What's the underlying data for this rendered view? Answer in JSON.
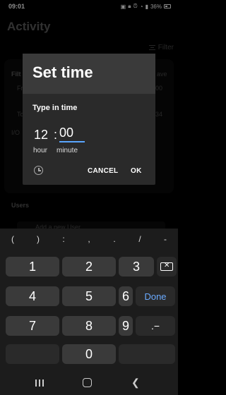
{
  "status_bar": {
    "time": "09:01",
    "battery": "36%",
    "icons": [
      "notification-icon",
      "lock-icon",
      "alarm-icon",
      "wifi-icon",
      "signal-icon",
      "battery-icon"
    ]
  },
  "background": {
    "title": "Activity",
    "filter_label": "Filter",
    "card_label": "Filt",
    "card_action": "ave",
    "field_from": "Fr",
    "field_from_value": "00",
    "field_to": "To",
    "field_to_value": "34",
    "io_label": "I/O",
    "users_label": "Users",
    "add_user": "Add a new User"
  },
  "dialog": {
    "title": "Set time",
    "type_label": "Type in time",
    "hour": "12",
    "colon": ":",
    "minute": "00",
    "hour_unit": "hour",
    "minute_unit": "minute",
    "cancel": "CANCEL",
    "ok": "OK"
  },
  "keyboard": {
    "symbols": [
      "(",
      ")",
      ":",
      ",",
      ".",
      "/",
      "-"
    ],
    "keys": {
      "k1": "1",
      "k2": "2",
      "k3": "3",
      "k4": "4",
      "k5": "5",
      "k6": "6",
      "done": "Done",
      "k7": "7",
      "k8": "8",
      "k9": "9",
      "dot_minus": ".−",
      "k0": "0"
    }
  }
}
